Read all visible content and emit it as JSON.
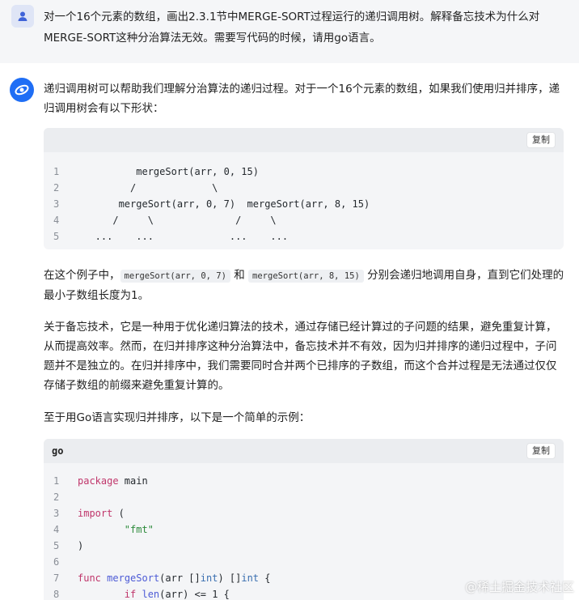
{
  "user": {
    "avatar_icon": "user-icon",
    "message": "对一个16个元素的数组，画出2.3.1节中MERGE-SORT过程运行的递归调用树。解释备忘技术为什么对MERGE-SORT这种分治算法无效。需要写代码的时候，请用go语言。"
  },
  "assistant": {
    "avatar_icon": "assistant-logo-icon",
    "intro": "递归调用树可以帮助我们理解分治算法的递归过程。对于一个16个元素的数组，如果我们使用归并排序，递归调用树会有以下形状：",
    "tree_code": {
      "copy_label": "复制",
      "lines": [
        {
          "n": "1",
          "code": "          mergeSort(arr, 0, 15)"
        },
        {
          "n": "2",
          "code": "         /             \\"
        },
        {
          "n": "3",
          "code": "       mergeSort(arr, 0, 7)  mergeSort(arr, 8, 15)"
        },
        {
          "n": "4",
          "code": "      /     \\              /     \\"
        },
        {
          "n": "5",
          "code": "   ...    ...             ...    ..."
        }
      ]
    },
    "para2_before": "在这个例子中，",
    "para2_code1": "mergeSort(arr, 0, 7)",
    "para2_mid": " 和 ",
    "para2_code2": "mergeSort(arr, 8, 15)",
    "para2_after": " 分别会递归地调用自身，直到它们处理的最小子数组长度为1。",
    "para3": "关于备忘技术，它是一种用于优化递归算法的技术，通过存储已经计算过的子问题的结果，避免重复计算，从而提高效率。然而，在归并排序这种分治算法中，备忘技术并不有效，因为归并排序的递归过程中，子问题并不是独立的。在归并排序中，我们需要同时合并两个已排序的子数组，而这个合并过程是无法通过仅仅存储子数组的前缀来避免重复计算的。",
    "para4": "至于用Go语言实现归并排序，以下是一个简单的示例：",
    "go_code": {
      "lang": "go",
      "copy_label": "复制",
      "lines": [
        {
          "n": "1",
          "code": "package main"
        },
        {
          "n": "2",
          "code": ""
        },
        {
          "n": "3",
          "code": "import ("
        },
        {
          "n": "4",
          "code": "        \"fmt\""
        },
        {
          "n": "5",
          "code": ")"
        },
        {
          "n": "6",
          "code": ""
        },
        {
          "n": "7",
          "code": "func mergeSort(arr []int) []int {"
        },
        {
          "n": "8",
          "code": "        if len(arr) <= 1 {"
        }
      ]
    }
  },
  "watermark": "@稀土掘金技术社区"
}
